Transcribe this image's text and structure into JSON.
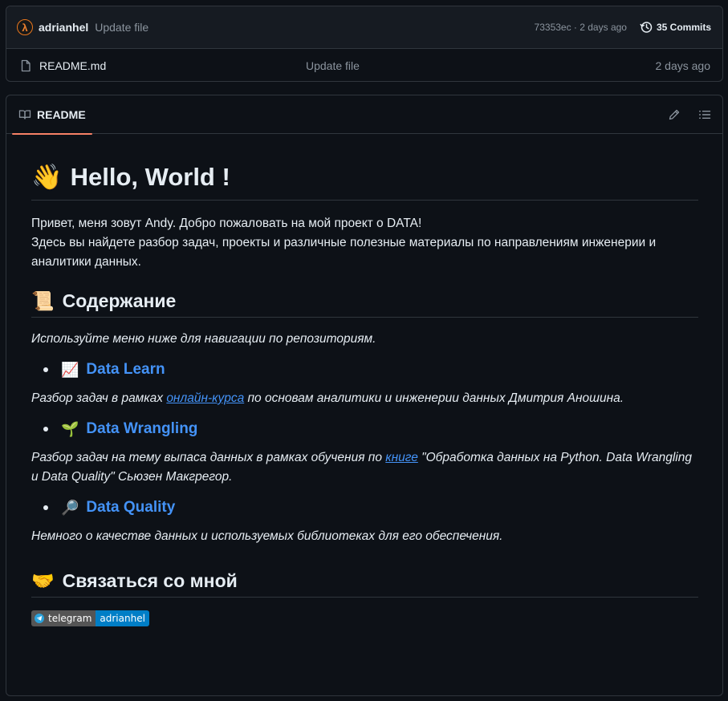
{
  "commit": {
    "avatar_letter": "λ",
    "author": "adrianhel",
    "message": "Update file",
    "meta": "73353ec · 2 days ago",
    "commits_label": "35 Commits"
  },
  "file": {
    "name": "README.md",
    "message": "Update file",
    "time": "2 days ago"
  },
  "readme": {
    "tab_label": "README",
    "title_emoji": "👋",
    "title": "Hello, World !",
    "intro_line1": "Привет, меня зовут Andy. Добро пожаловать на мой проект о DATA!",
    "intro_line2": "Здесь вы найдете разбор задач, проекты и различные полезные материалы по направлениям инженерии и аналитики данных.",
    "contents_emoji": "📜",
    "contents_title": "Содержание",
    "contents_note": "Используйте меню ниже для навигации по репозиториям.",
    "items": [
      {
        "emoji": "📈",
        "label": "Data Learn",
        "desc_before": "Разбор задач в рамках ",
        "desc_link": "онлайн-курса",
        "desc_after": " по основам аналитики и инженерии данных Дмитрия Аношина."
      },
      {
        "emoji": "🌱",
        "label": "Data Wrangling",
        "desc_before": "Разбор задач на тему выпаса данных в рамках обучения по ",
        "desc_link": "книге",
        "desc_after": " \"Обработка данных на Python. Data Wrangling и Data Quality\" Сьюзен Макгрегор."
      },
      {
        "emoji": "🔎",
        "label": "Data Quality",
        "desc": "Немного о качестве данных и используемых библиотеках для его обеспечения."
      }
    ],
    "contact_emoji": "🤝",
    "contact_title": "Связаться со мной",
    "badge_left": "telegram",
    "badge_right": "adrianhel"
  },
  "colors": {
    "background": "#0d1117",
    "link": "#4493f8",
    "tab_underline": "#f78166",
    "badge_left": "#555555",
    "badge_right": "#007ec6"
  },
  "icons": {
    "commits": "history-icon",
    "file": "file-icon",
    "readme": "book-icon",
    "edit": "pencil-icon",
    "outline": "list-icon"
  }
}
